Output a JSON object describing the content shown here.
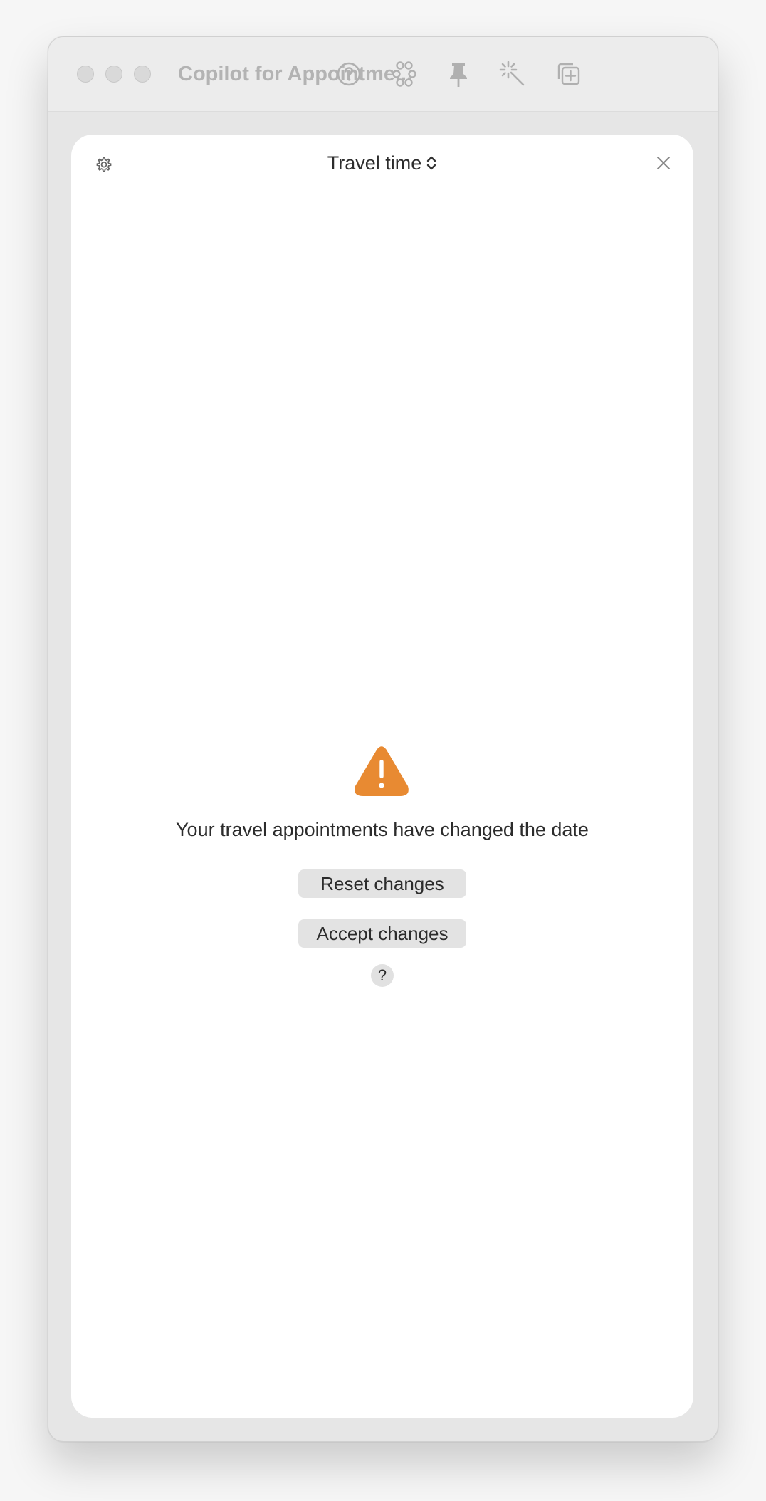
{
  "window": {
    "title": "Copilot for Appointme...",
    "toolbar_icons": [
      "help-icon",
      "shortcuts-icon",
      "pin-icon",
      "magic-icon",
      "new-window-icon"
    ]
  },
  "panel": {
    "mode_label": "Travel time",
    "settings_icon": "gear-icon",
    "close_icon": "close-icon"
  },
  "alert": {
    "icon": "warning-icon",
    "icon_color": "#E88A32",
    "message": "Your travel appointments have changed the date",
    "reset_label": "Reset changes",
    "accept_label": "Accept changes",
    "help_label": "?"
  }
}
